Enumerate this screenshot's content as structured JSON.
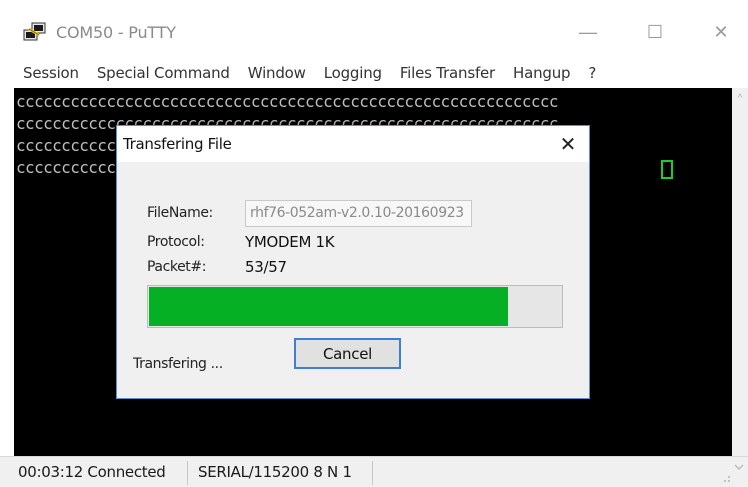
{
  "window": {
    "title": "COM50 - PuTTY",
    "controls": {
      "minimize": "—",
      "maximize": "☐",
      "close": "✕"
    }
  },
  "menu": [
    "Session",
    "Special Command",
    "Window",
    "Logging",
    "Files Transfer",
    "Hangup",
    "?"
  ],
  "terminal": {
    "lines": [
      "cccccccccccccccccccccccccccccccccccccccccccccccccccccccccccc",
      "cccccccccccccccccccccccccccccccccccccccccccccccccccccccccccc",
      "cccccccccccccccccccccccccccccccccccccccccccccccccccccccccccc",
      "cccccccccccccccccccccccccccccccccccccccccccccccccccccc"
    ],
    "colors": {
      "background": "#000000",
      "text": "#bdbdbd",
      "cursor": "#19d02a"
    }
  },
  "scrollbar": {
    "up_arrow": "^"
  },
  "status_bar": {
    "connection": "00:03:12 Connected",
    "serial": "SERIAL/115200 8 N 1"
  },
  "dialog": {
    "title": "Transfering File",
    "close_glyph": "✕",
    "filename_label": "FileName:",
    "filename_value": "rhf76-052am-v2.0.10-20160923",
    "protocol_label": "Protocol:",
    "protocol_value": "YMODEM 1K",
    "packet_label": "Packet#:",
    "packet_value": "53/57",
    "progress_fraction": 0.871,
    "progress_color": "#06b025",
    "cancel_label": "Cancel",
    "status": "Transfering ..."
  }
}
